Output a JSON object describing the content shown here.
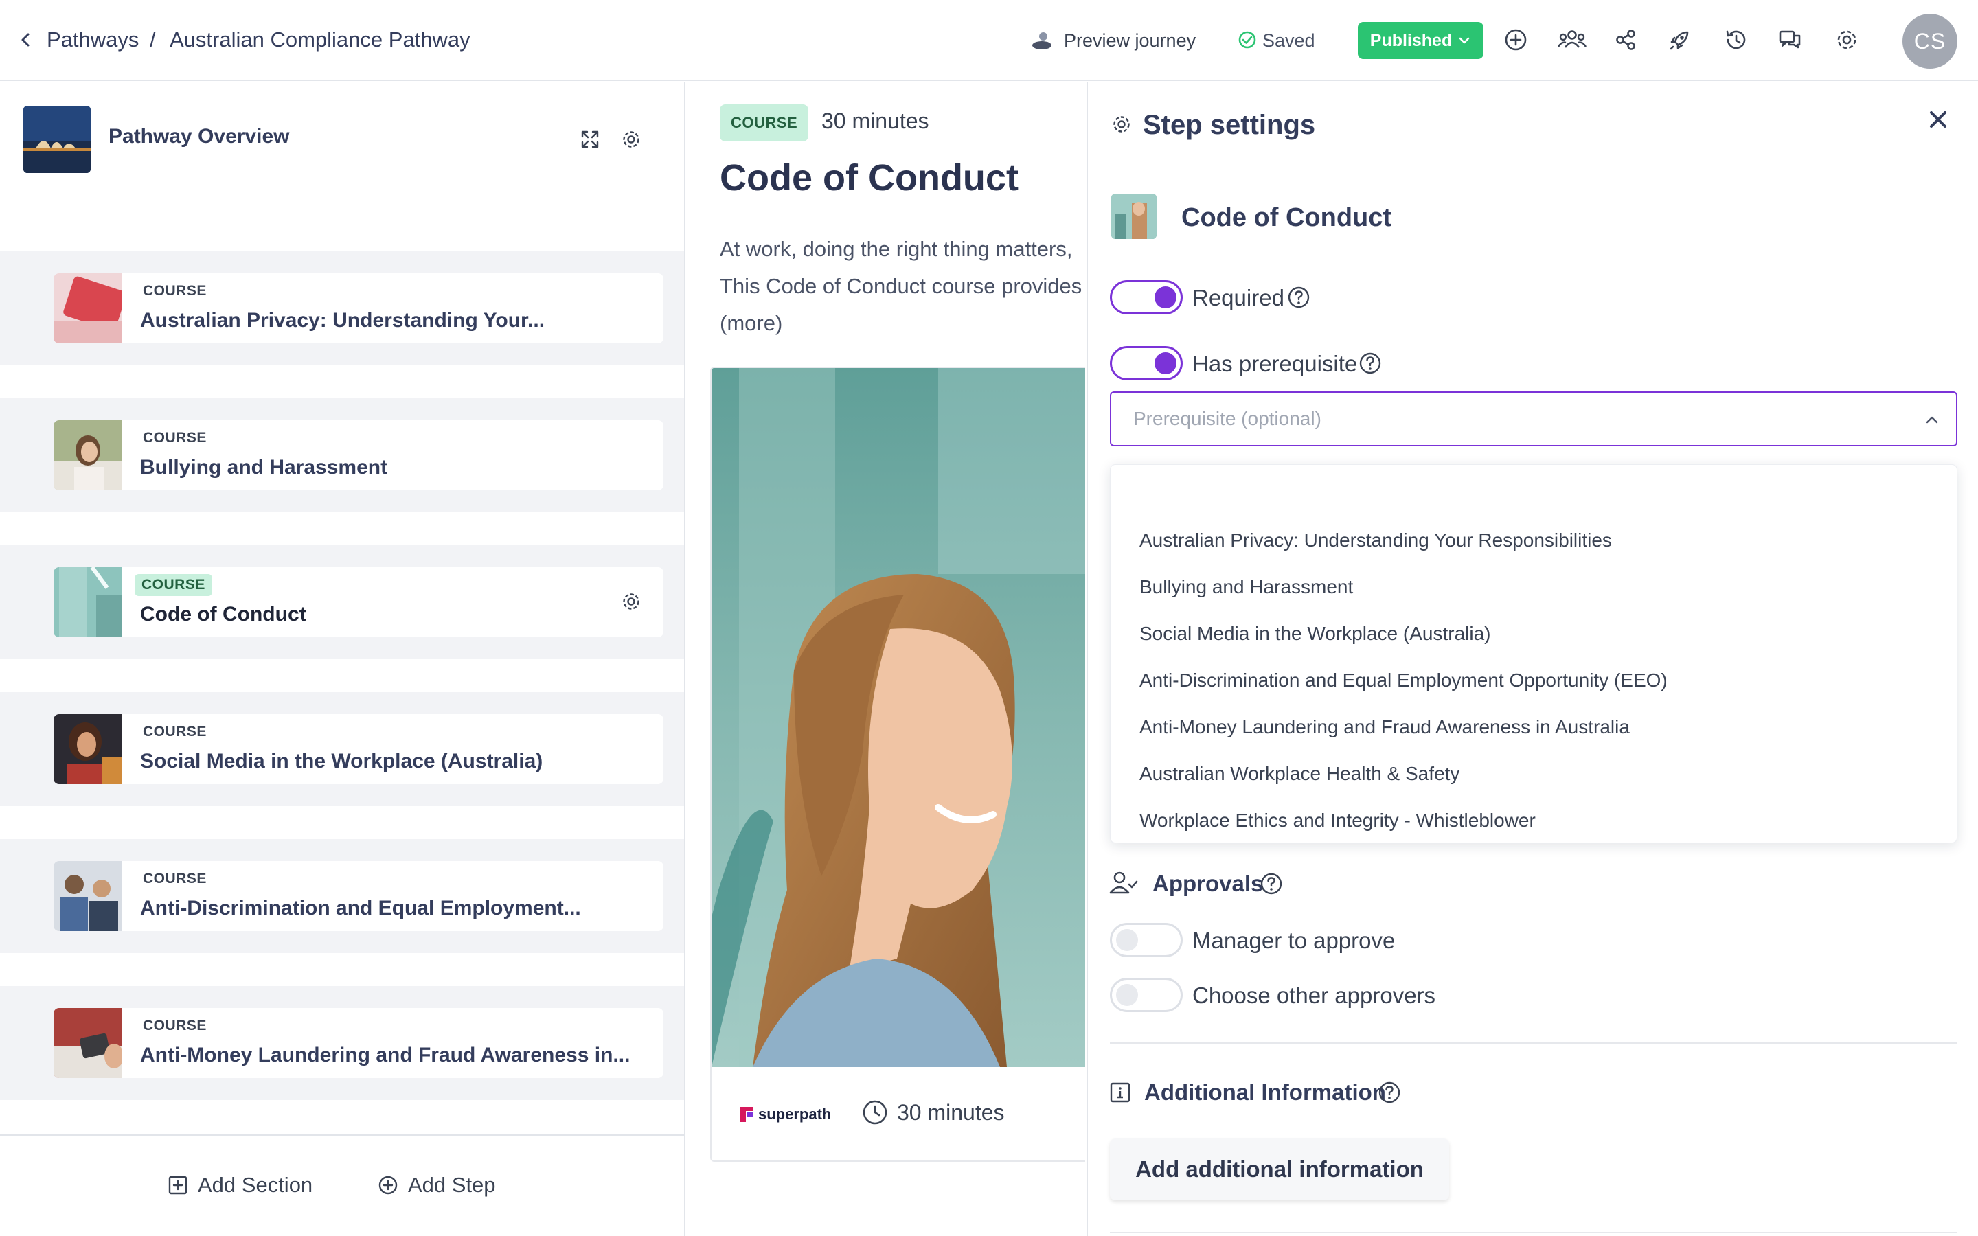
{
  "header": {
    "breadcrumb_root": "Pathways",
    "breadcrumb_sep": "/",
    "breadcrumb_current": "Australian Compliance Pathway",
    "preview_label": "Preview journey",
    "saved_label": "Saved",
    "published_label": "Published",
    "avatar_initials": "CS",
    "icons": [
      "back-chevron-icon",
      "preview-icon",
      "check-circle-icon",
      "chevron-down-icon",
      "plus-circle-icon",
      "users-icon",
      "share-icon",
      "rocket-icon",
      "history-icon",
      "chat-icon",
      "settings-icon"
    ]
  },
  "sidebar": {
    "overview_title": "Pathway Overview",
    "steps": [
      {
        "tag": "COURSE",
        "title": "Australian Privacy: Understanding Your...",
        "active": false
      },
      {
        "tag": "COURSE",
        "title": "Bullying and Harassment",
        "active": false
      },
      {
        "tag": "COURSE",
        "title": "Code of Conduct",
        "active": true
      },
      {
        "tag": "COURSE",
        "title": "Social Media in the Workplace (Australia)",
        "active": false
      },
      {
        "tag": "COURSE",
        "title": "Anti-Discrimination and Equal Employment...",
        "active": false
      },
      {
        "tag": "COURSE",
        "title": "Anti-Money Laundering and Fraud Awareness in...",
        "active": false
      }
    ],
    "add_section_label": "Add Section",
    "add_step_label": "Add Step"
  },
  "preview": {
    "tag": "COURSE",
    "duration": "30 minutes",
    "title": "Code of Conduct",
    "description_line1": "At work, doing the right thing matters,",
    "description_line2": "This Code of Conduct course provides",
    "description_more": "(more)",
    "provider_logo": "superpath",
    "footer_duration": "30 minutes"
  },
  "step_settings": {
    "title": "Step settings",
    "step_name": "Code of Conduct",
    "required_label": "Required",
    "required_on": true,
    "prerequisite_label": "Has prerequisite",
    "prerequisite_on": true,
    "prerequisite_placeholder": "Prerequisite (optional)",
    "prerequisite_options": [
      "Australian Privacy: Understanding Your Responsibilities",
      "Bullying and Harassment",
      "Social Media in the Workplace (Australia)",
      "Anti-Discrimination and Equal Employment Opportunity (EEO)",
      "Anti-Money Laundering and Fraud Awareness in Australia",
      "Australian Workplace Health & Safety",
      "Workplace Ethics and Integrity - Whistleblower"
    ],
    "approvals_title": "Approvals",
    "manager_approve_label": "Manager to approve",
    "manager_approve_on": false,
    "other_approvers_label": "Choose other approvers",
    "other_approvers_on": false,
    "additional_info_title": "Additional Information",
    "add_info_button": "Add additional information"
  },
  "colors": {
    "accent_purple": "#7b33d8",
    "published_green": "#2bc472",
    "course_tag_bg": "#c8f0dd",
    "text_dark": "#343d5c"
  }
}
